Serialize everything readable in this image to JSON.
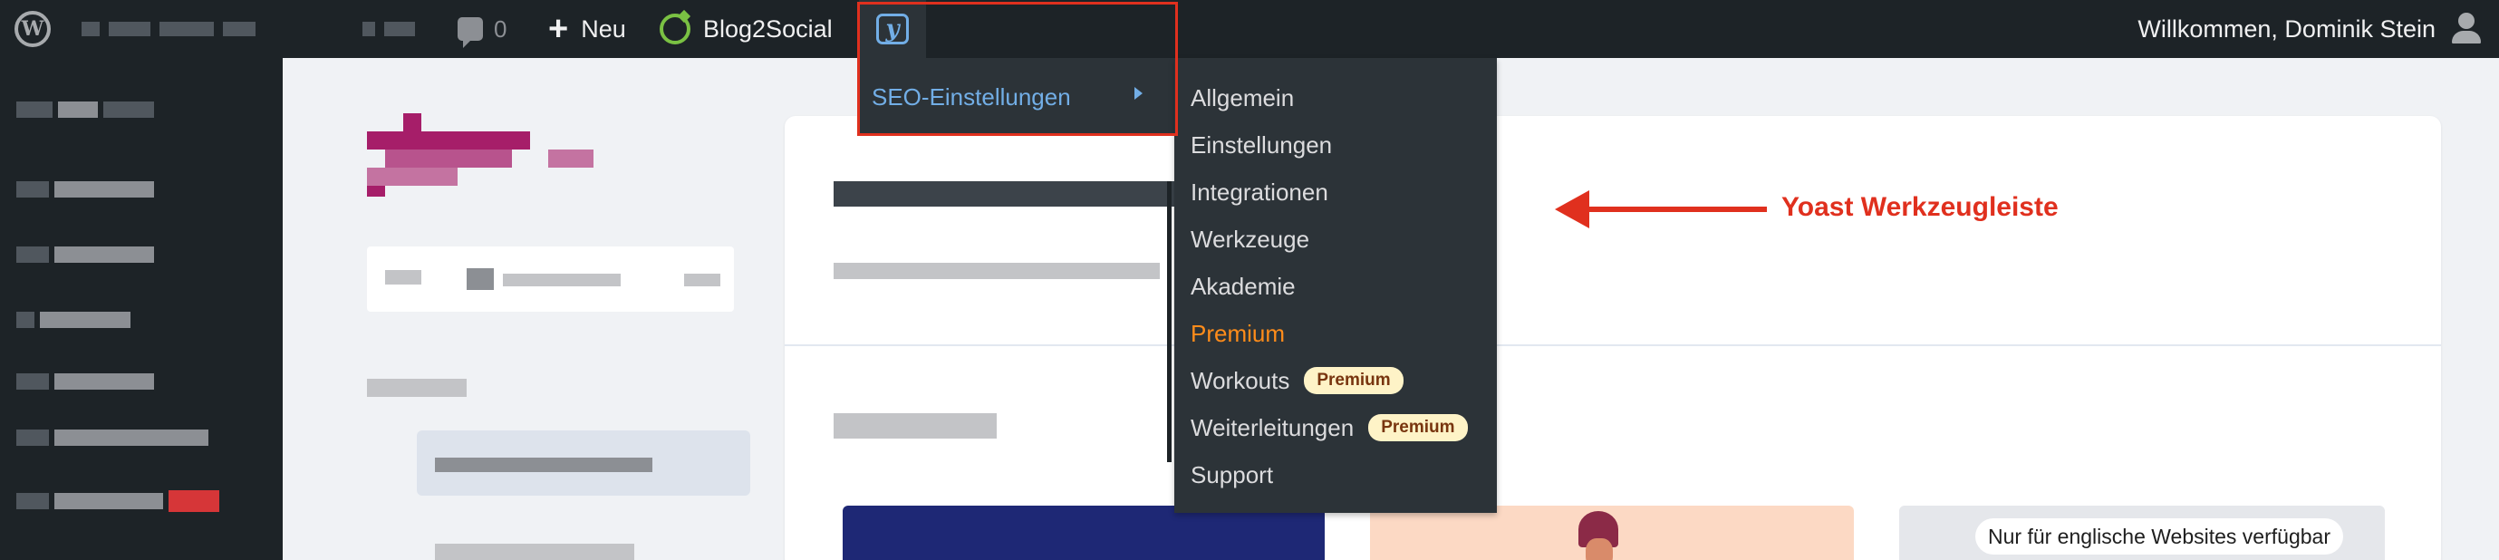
{
  "admin_bar": {
    "comments_count": "0",
    "new_label": "Neu",
    "blog2social_label": "Blog2Social",
    "greeting": "Willkommen, Dominik Stein"
  },
  "yoast_menu": {
    "top_item": "SEO-Einstellungen",
    "submenu": [
      {
        "label": "Allgemein"
      },
      {
        "label": "Einstellungen"
      },
      {
        "label": "Integrationen"
      },
      {
        "label": "Werkzeuge"
      },
      {
        "label": "Akademie"
      },
      {
        "label": "Premium"
      },
      {
        "label": "Workouts",
        "badge": "Premium"
      },
      {
        "label": "Weiterleitungen",
        "badge": "Premium"
      },
      {
        "label": "Support"
      }
    ]
  },
  "main": {
    "english_only_badge": "Nur für englische Websites verfügbar"
  },
  "annotation": {
    "label": "Yoast Werkzeugleiste"
  },
  "colors": {
    "admin_bar_bg": "#1d2327",
    "submenu_bg": "#2c3338",
    "link_blue": "#72aee6",
    "premium_orange": "#ff8c1a",
    "annotation_red": "#e0301e",
    "yoast_brand": "#a61e69"
  },
  "icons": [
    "wordpress-logo-icon",
    "comment-bubble-icon",
    "plus-icon",
    "blog2social-icon",
    "yoast-logo-icon",
    "user-avatar-icon",
    "submenu-arrow-icon",
    "left-arrow-annotation-icon"
  ]
}
